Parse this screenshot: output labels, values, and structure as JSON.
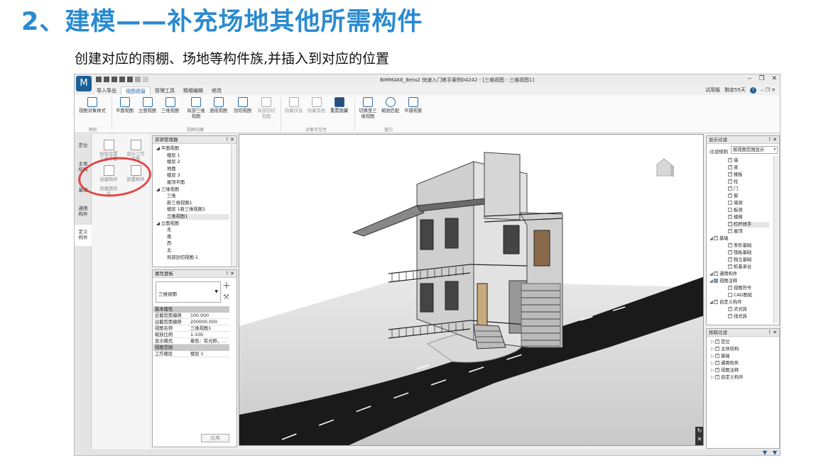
{
  "slide": {
    "title": "2、建模——补充场地其他所需构件",
    "subtitle": "创建对应的雨棚、场地等构件族,并插入到对应的位置"
  },
  "colors": {
    "title": "#2a8ad0",
    "accent": "#1c5f99",
    "circle": "#e02828"
  },
  "app": {
    "window_title": "BIMMAKE_Beta2 快速入门练手案例04242 - [三维视图 - 三维视图1]",
    "menu_tabs": [
      "导入导出",
      "视图视窗",
      "管理工具",
      "精细编辑",
      "修改"
    ],
    "active_tab": "视图视窗",
    "right_info": {
      "trial": "试用版",
      "days": "剩余55天"
    },
    "ribbon": {
      "buttons": [
        "视图对象样式",
        "平面视图",
        "立面视图",
        "三维视图",
        "局部三维视图",
        "透视视图",
        "剖切视图",
        "局部剖切视图",
        "隐藏所选",
        "隐藏其他",
        "重置隐藏",
        "切换至三维视图",
        "缩放匹配",
        "平铺视窗"
      ],
      "groups": [
        "图形",
        "视图创建",
        "对象可见性",
        "窗口"
      ]
    },
    "left_tabs": [
      "定位",
      "主体结构",
      "基础",
      "通用构件",
      "定义构件"
    ],
    "tools": [
      "拾取设置工作平面",
      "显示工作平面",
      "创建构件",
      "放置构件",
      "创建面划分"
    ],
    "resource_manager": {
      "title": "资源管理器",
      "tree": [
        {
          "label": "平面视图",
          "level": 0
        },
        {
          "label": "楼层 1",
          "level": 1
        },
        {
          "label": "楼层 2",
          "level": 1
        },
        {
          "label": "地面",
          "level": 1
        },
        {
          "label": "楼层 3",
          "level": 1
        },
        {
          "label": "屋顶平面",
          "level": 1
        },
        {
          "label": "三维视图",
          "level": 0
        },
        {
          "label": "三维",
          "level": 1
        },
        {
          "label": "新三维视图1",
          "level": 1
        },
        {
          "label": "楼层 1新三维视图1",
          "level": 1
        },
        {
          "label": "三维视图1",
          "level": 1,
          "selected": true
        },
        {
          "label": "立面视图",
          "level": 0
        },
        {
          "label": "东",
          "level": 1
        },
        {
          "label": "南",
          "level": 1
        },
        {
          "label": "西",
          "level": 1
        },
        {
          "label": "北",
          "level": 1
        },
        {
          "label": "局部剖切视图-1",
          "level": 1
        }
      ]
    },
    "properties": {
      "title": "属性面板",
      "type": "三维视图",
      "groups": [
        {
          "name": "基本属性",
          "rows": [
            [
              "近截剪面偏移",
              "100.000"
            ],
            [
              "远截剪面偏移",
              "200000.000"
            ],
            [
              "视图名称",
              "三维视图1"
            ],
            [
              "缩放比例",
              "1:100"
            ],
            [
              "显示模式",
              "着色：有光照，..."
            ]
          ]
        },
        {
          "name": "视图范围",
          "rows": [
            [
              "工作楼层",
              "楼层 1"
            ]
          ]
        }
      ],
      "apply": "应用"
    },
    "display_filter": {
      "title": "显示过滤",
      "rule_label": "过滤规则",
      "rule_value": "按视图范围显示",
      "items": [
        {
          "label": "墙",
          "checked": true,
          "level": 1
        },
        {
          "label": "梁",
          "checked": true,
          "level": 1
        },
        {
          "label": "楼板",
          "checked": true,
          "level": 1
        },
        {
          "label": "柱",
          "checked": true,
          "level": 1
        },
        {
          "label": "门",
          "checked": true,
          "level": 1
        },
        {
          "label": "窗",
          "checked": true,
          "level": 1
        },
        {
          "label": "墙洞",
          "checked": false,
          "level": 1
        },
        {
          "label": "板洞",
          "checked": false,
          "level": 1
        },
        {
          "label": "楼梯",
          "checked": true,
          "level": 1
        },
        {
          "label": "栏杆扶手",
          "checked": true,
          "level": 1,
          "selected": true
        },
        {
          "label": "屋顶",
          "checked": true,
          "level": 1
        },
        {
          "label": "基础",
          "checked": true,
          "level": 0
        },
        {
          "label": "条形基础",
          "checked": true,
          "level": 1
        },
        {
          "label": "筏板基础",
          "checked": true,
          "level": 1
        },
        {
          "label": "独立基础",
          "checked": true,
          "level": 1
        },
        {
          "label": "桩基承台",
          "checked": true,
          "level": 1
        },
        {
          "label": "通用构件",
          "checked": true,
          "level": 0
        },
        {
          "label": "视图注释",
          "checked": "partial",
          "level": 0
        },
        {
          "label": "视图符号",
          "checked": true,
          "level": 1
        },
        {
          "label": "CAD图纸",
          "checked": false,
          "level": 1
        },
        {
          "label": "自定义构件",
          "checked": true,
          "level": 0
        },
        {
          "label": "点式族",
          "checked": true,
          "level": 1
        },
        {
          "label": "线式族",
          "checked": true,
          "level": 1
        }
      ]
    },
    "pick_filter": {
      "title": "拾取过滤",
      "items": [
        "定位",
        "主体结构",
        "基础",
        "通用构件",
        "视图注释",
        "自定义构件"
      ]
    }
  }
}
